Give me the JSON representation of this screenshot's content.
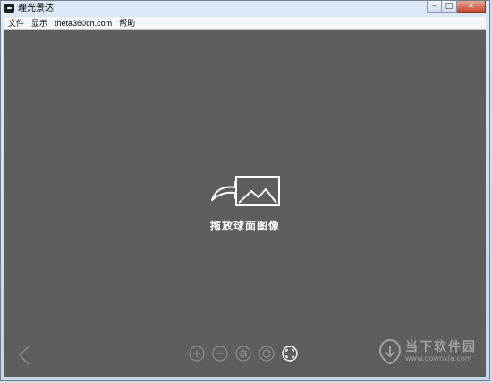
{
  "window": {
    "title": "理光景达",
    "buttons": {
      "minimize": "–",
      "maximize": "□",
      "close": "✕"
    }
  },
  "menu": [
    {
      "label": "文件"
    },
    {
      "label": "显示"
    },
    {
      "label": "theta360cn.com"
    },
    {
      "label": "帮助"
    }
  ],
  "viewer": {
    "drop_label": "拖放球面图像"
  },
  "toolbar": {
    "items": [
      {
        "name": "zoom-in-icon"
      },
      {
        "name": "zoom-out-icon"
      },
      {
        "name": "settings-icon"
      },
      {
        "name": "refresh-icon"
      },
      {
        "name": "fullscreen-icon"
      }
    ]
  },
  "watermark": {
    "main": "当下软件园",
    "sub": "www.downxia.com"
  },
  "colors": {
    "viewer_bg": "#5e5e5e",
    "frame": "#cfdcea",
    "close_button": "#c5422b"
  }
}
